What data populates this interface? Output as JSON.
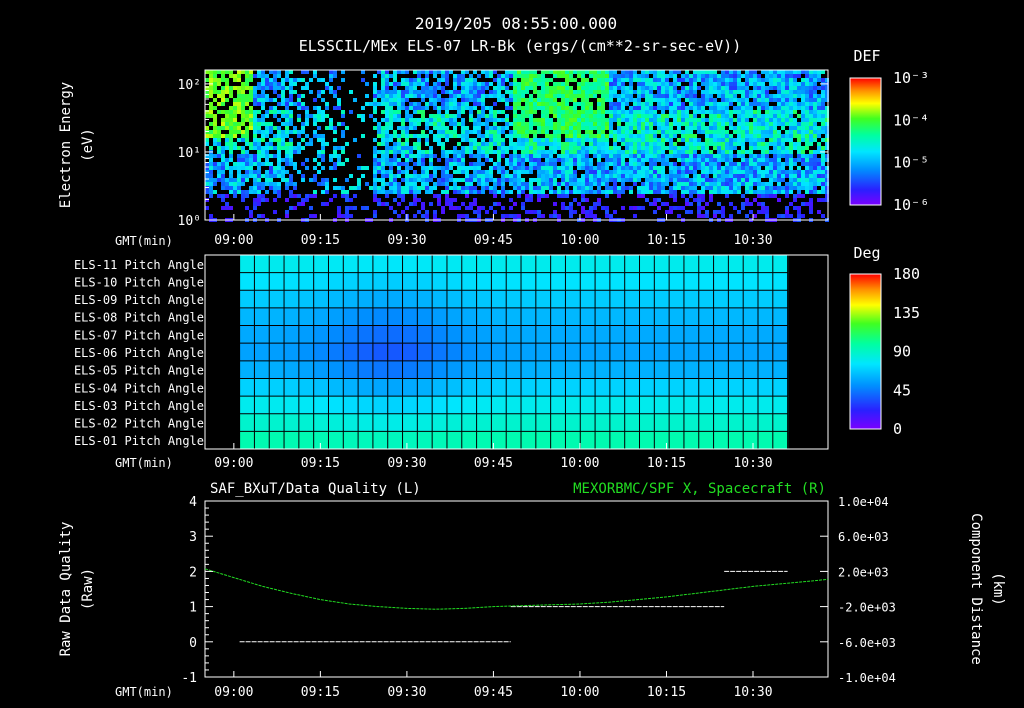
{
  "title": "2019/205 08:55:00.000",
  "subtitle": "ELSSCIL/MEx ELS-07 LR-Bk  (ergs/(cm**2-sr-sec-eV))",
  "colors": {
    "background": "#000000",
    "foreground": "#ffffff",
    "spf_line": "#22dd22",
    "right_title": "#22dd22"
  },
  "chart_data": [
    {
      "type": "heatmap",
      "ylabel": [
        "Electron Energy",
        "(eV)"
      ],
      "ylog": true,
      "ylim": [
        1,
        160
      ],
      "yticks": [
        {
          "value": 1,
          "label": "10⁰"
        },
        {
          "value": 10,
          "label": "10¹"
        },
        {
          "value": 100,
          "label": "10²"
        }
      ],
      "xlabel": "GMT(min)",
      "xlim": [
        "08:55",
        "10:43"
      ],
      "xticks": [
        "09:00",
        "09:15",
        "09:30",
        "09:45",
        "10:00",
        "10:15",
        "10:30"
      ],
      "colorbar": {
        "title": "DEF",
        "log": true,
        "range": [
          1e-06,
          0.001
        ],
        "ticks": [
          {
            "value": 0.001,
            "label": "10⁻³"
          },
          {
            "value": 0.0001,
            "label": "10⁻⁴"
          },
          {
            "value": 1e-05,
            "label": "10⁻⁵"
          },
          {
            "value": 1e-06,
            "label": "10⁻⁶"
          }
        ]
      }
    },
    {
      "type": "heatmap",
      "ylabel": [],
      "rows": [
        "ELS-11 Pitch Angle",
        "ELS-10 Pitch Angle",
        "ELS-09 Pitch Angle",
        "ELS-08 Pitch Angle",
        "ELS-07 Pitch Angle",
        "ELS-06 Pitch Angle",
        "ELS-05 Pitch Angle",
        "ELS-04 Pitch Angle",
        "ELS-03 Pitch Angle",
        "ELS-02 Pitch Angle",
        "ELS-01 Pitch Angle"
      ],
      "data_start": "09:01",
      "data_end": "10:36",
      "row_base_values": [
        80,
        75,
        68,
        62,
        58,
        56,
        60,
        70,
        80,
        88,
        95
      ],
      "dip": {
        "center": "09:27",
        "width_min": 12,
        "depth": 20
      },
      "xlabel": "GMT(min)",
      "xlim": [
        "08:55",
        "10:43"
      ],
      "xticks": [
        "09:00",
        "09:15",
        "09:30",
        "09:45",
        "10:00",
        "10:15",
        "10:30"
      ],
      "colorbar": {
        "title": "Deg",
        "log": false,
        "range": [
          0,
          180
        ],
        "ticks": [
          {
            "value": 180,
            "label": "180"
          },
          {
            "value": 135,
            "label": "135"
          },
          {
            "value": 90,
            "label": "90"
          },
          {
            "value": 45,
            "label": "45"
          },
          {
            "value": 0,
            "label": "0"
          }
        ]
      }
    },
    {
      "type": "line",
      "title_left": "SAF_BXuT/Data Quality (L)",
      "title_right": "MEXORBMC/SPF X, Spacecraft (R)",
      "ylabel_left": [
        "Raw Data Quality",
        "(Raw)"
      ],
      "ylabel_right": [
        "Component Distance",
        "(km)"
      ],
      "ylim_left": [
        -1,
        4
      ],
      "yticks_left": [
        "-1",
        "0",
        "1",
        "2",
        "3",
        "4"
      ],
      "ylim_right": [
        -10000,
        10000
      ],
      "yticks_right": [
        {
          "value": 10000,
          "label": "1.0e+04"
        },
        {
          "value": 6000,
          "label": "6.0e+03"
        },
        {
          "value": 2000,
          "label": "2.0e+03"
        },
        {
          "value": -2000,
          "label": "-2.0e+03"
        },
        {
          "value": -6000,
          "label": "-6.0e+03"
        },
        {
          "value": -10000,
          "label": "-1.0e+04"
        }
      ],
      "xlabel": "GMT(min)",
      "xlim": [
        "08:55",
        "10:43"
      ],
      "xticks": [
        "09:00",
        "09:15",
        "09:30",
        "09:45",
        "10:00",
        "10:15",
        "10:30"
      ],
      "series": [
        {
          "name": "SAF_BXuT/Data Quality",
          "axis": "left",
          "segments": [
            {
              "x": [
                "09:01",
                "09:48"
              ],
              "y": 0
            },
            {
              "x": [
                "09:48",
                "10:25"
              ],
              "y": 1
            },
            {
              "x": [
                "10:25",
                "10:36"
              ],
              "y": 2
            }
          ]
        },
        {
          "name": "MEXORBMC/SPF X, Spacecraft",
          "axis": "right",
          "x": [
            "08:55",
            "09:00",
            "09:05",
            "09:10",
            "09:15",
            "09:20",
            "09:25",
            "09:30",
            "09:35",
            "09:40",
            "09:45",
            "09:50",
            "09:55",
            "10:00",
            "10:05",
            "10:10",
            "10:15",
            "10:20",
            "10:25",
            "10:30",
            "10:35",
            "10:40",
            "10:43"
          ],
          "y": [
            2300,
            1300,
            300,
            -500,
            -1200,
            -1700,
            -2000,
            -2200,
            -2300,
            -2200,
            -2000,
            -1900,
            -1800,
            -1700,
            -1500,
            -1200,
            -900,
            -500,
            -100,
            300,
            600,
            900,
            1100
          ]
        }
      ]
    }
  ]
}
